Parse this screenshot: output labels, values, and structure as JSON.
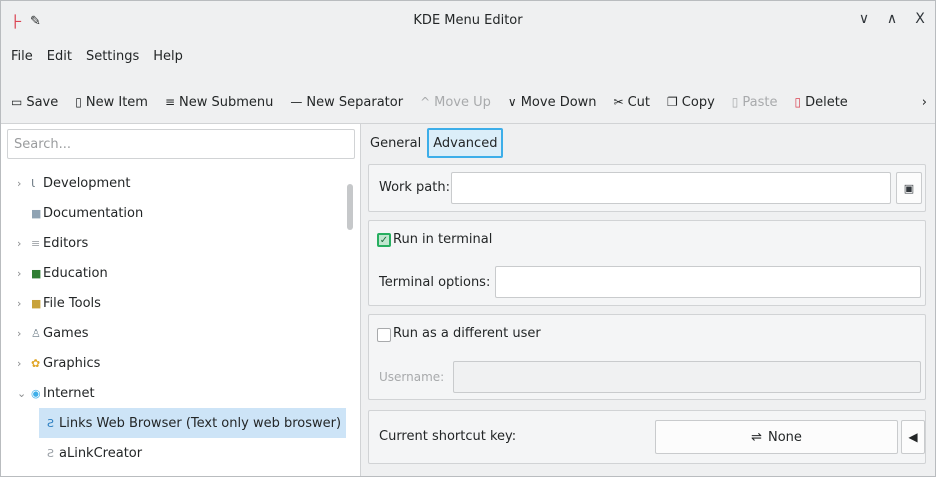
{
  "window": {
    "title": "KDE Menu Editor",
    "controls": {
      "minimize": "∨",
      "maximize": "∧",
      "close": "X"
    }
  },
  "menubar": [
    "File",
    "Edit",
    "Settings",
    "Help"
  ],
  "toolbar": {
    "save": "Save",
    "new_item": "New Item",
    "new_submenu": "New Submenu",
    "new_separator": "New Separator",
    "move_up": "Move Up",
    "move_down": "Move Down",
    "cut": "Cut",
    "copy": "Copy",
    "paste": "Paste",
    "delete": "Delete",
    "more": "›"
  },
  "icons": {
    "save": "▭",
    "new_item": "▯",
    "new_submenu": "≡",
    "new_separator": "—",
    "move_up": "^",
    "move_down": "∨",
    "cut": "✂",
    "copy": "❐",
    "paste": "▯",
    "delete": "▯"
  },
  "search": {
    "placeholder": "Search..."
  },
  "tree": [
    {
      "label": "Development",
      "icon": "Ɩ",
      "color": "#6d7a83"
    },
    {
      "label": "Documentation",
      "icon": "■",
      "color": "#8fa3b3"
    },
    {
      "label": "Editors",
      "icon": "≡",
      "color": "#a0a4a8"
    },
    {
      "label": "Education",
      "icon": "■",
      "color": "#2e7d32"
    },
    {
      "label": "File Tools",
      "icon": "■",
      "color": "#c8a23a"
    },
    {
      "label": "Games",
      "icon": "♙",
      "color": "#7c8a94"
    },
    {
      "label": "Graphics",
      "icon": "✿",
      "color": "#e0a526"
    },
    {
      "label": "Internet",
      "icon": "◉",
      "color": "#3daee9"
    },
    {
      "label": "Links Web Browser (Text only web broswer)",
      "icon": "Ƨ",
      "color": "#2d7fc1"
    },
    {
      "label": "aLinkCreator",
      "icon": "Ƨ",
      "color": "#9aa0a6"
    }
  ],
  "tabs": {
    "general": "General",
    "advanced": "Advanced"
  },
  "advanced": {
    "work_path_label": "Work path:",
    "work_path_value": "",
    "run_in_terminal_label": "Run in terminal",
    "run_in_terminal_checked": true,
    "terminal_options_label": "Terminal options:",
    "terminal_options_value": "",
    "run_as_user_label": "Run as a different user",
    "run_as_user_checked": false,
    "username_label": "Username:",
    "username_value": "",
    "shortcut_label": "Current shortcut key:",
    "shortcut_value": "None",
    "browse_icon": "▣",
    "clear_icon": "◀"
  },
  "colors": {
    "accent": "#3daee9",
    "selection": "#cde4f7",
    "check_green": "#27ae60",
    "delete_red": "#da4453"
  }
}
